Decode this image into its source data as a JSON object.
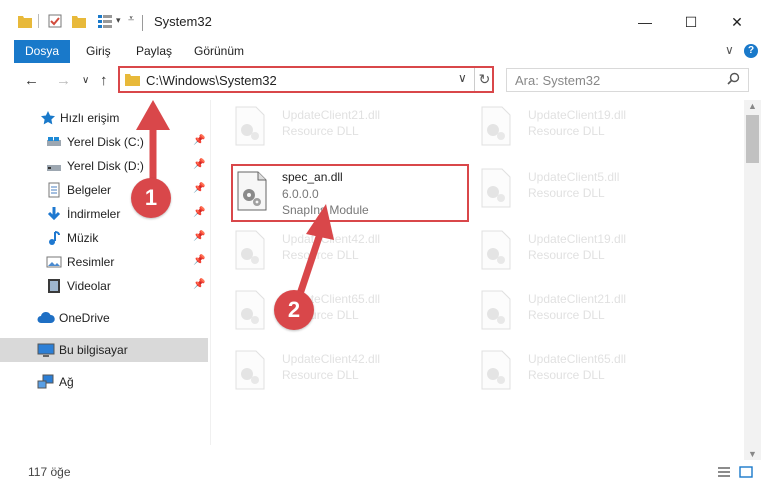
{
  "window": {
    "title": "System32",
    "minimize": "—",
    "maximize": "☐",
    "close": "✕"
  },
  "ribbon": {
    "tabs": [
      "Dosya",
      "Giriş",
      "Paylaş",
      "Görünüm"
    ],
    "expand": "∨",
    "help": "?"
  },
  "nav": {
    "back": "←",
    "forward": "→",
    "recent": "∨",
    "up": "↑"
  },
  "address": {
    "path": "C:\\Windows\\System32",
    "dropdown": "∨",
    "refresh": "↻"
  },
  "search": {
    "placeholder": "Ara: System32",
    "icon": "search-icon"
  },
  "sidebar": {
    "items": [
      {
        "label": "Hızlı erişim",
        "icon": "star-icon",
        "pinned": false
      },
      {
        "label": "Yerel Disk (C:)",
        "icon": "drive-icon",
        "pinned": true
      },
      {
        "label": "Yerel Disk (D:)",
        "icon": "drive-icon",
        "pinned": true
      },
      {
        "label": "Belgeler",
        "icon": "documents-icon",
        "pinned": true
      },
      {
        "label": "İndirmeler",
        "icon": "download-icon",
        "pinned": true
      },
      {
        "label": "Müzik",
        "icon": "music-icon",
        "pinned": true
      },
      {
        "label": "Resimler",
        "icon": "pictures-icon",
        "pinned": true
      },
      {
        "label": "Videolar",
        "icon": "video-icon",
        "pinned": true
      },
      {
        "label": "OneDrive",
        "icon": "cloud-icon",
        "pinned": false
      },
      {
        "label": "Bu bilgisayar",
        "icon": "computer-icon",
        "pinned": false
      },
      {
        "label": "Ağ",
        "icon": "network-icon",
        "pinned": false
      }
    ],
    "pin_glyph": "📌"
  },
  "files": {
    "left_column": [
      {
        "name": "UpdateClient21.dll",
        "type": "Resource DLL"
      },
      {
        "name": "spec_an.dll",
        "type": "6.0.0.0",
        "description": "SnapIns Module"
      },
      {
        "name": "UpdateClient42.dll",
        "type": "Resource DLL"
      },
      {
        "name": "UpdateClient65.dll",
        "type": "Resource DLL"
      },
      {
        "name": "UpdateClient42.dll",
        "type": "Resource DLL"
      }
    ],
    "right_column": [
      {
        "name": "UpdateClient19.dll",
        "type": "Resource DLL"
      },
      {
        "name": "UpdateClient5.dll",
        "type": "Resource DLL"
      },
      {
        "name": "UpdateClient19.dll",
        "type": "Resource DLL"
      },
      {
        "name": "UpdateClient21.dll",
        "type": "Resource DLL"
      },
      {
        "name": "UpdateClient65.dll",
        "type": "Resource DLL"
      }
    ]
  },
  "callouts": {
    "step1": "1",
    "step2": "2",
    "color": "#d9474a"
  },
  "status": {
    "count": "117 öğe"
  },
  "colors": {
    "accent": "#1979ca",
    "highlight": "#d9474a",
    "selected": "#d9d9d9"
  }
}
